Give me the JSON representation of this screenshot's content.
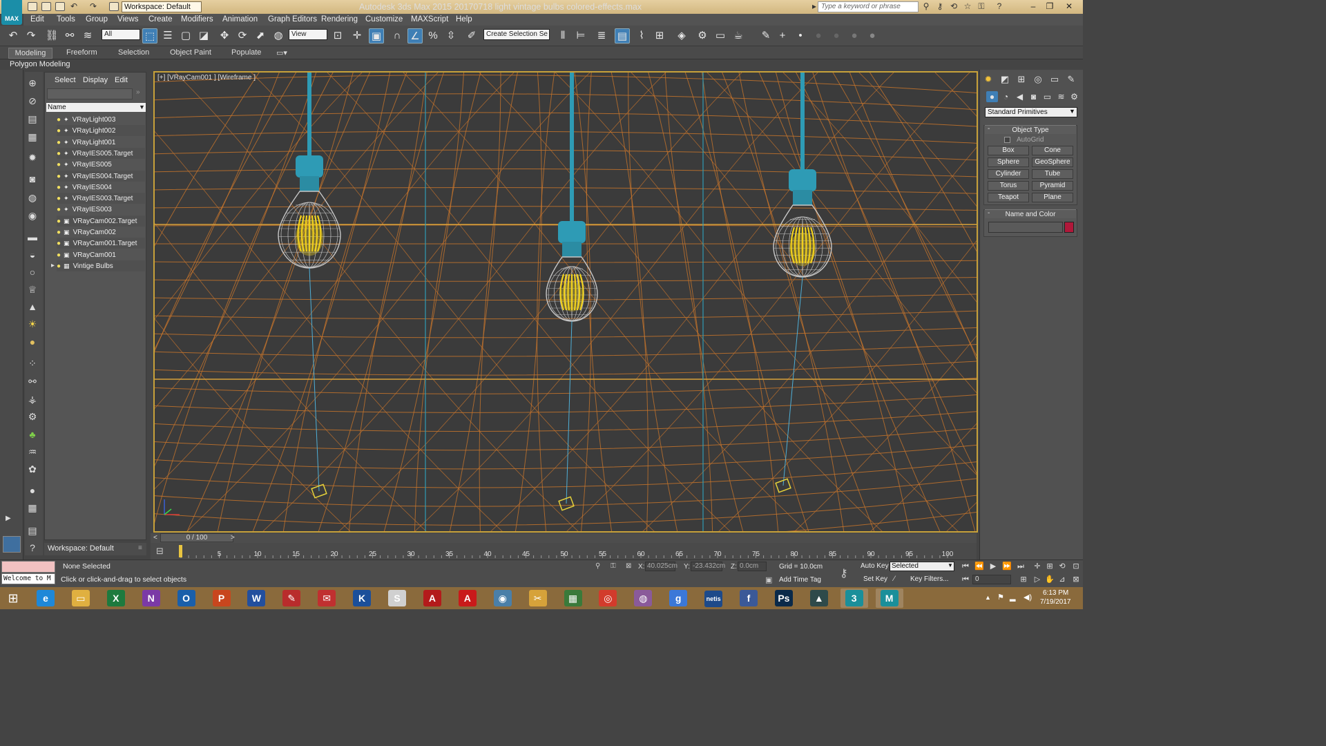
{
  "window": {
    "app_badge": "MAX",
    "title": "Autodesk 3ds Max  2015     20170718 light vintage bulbs colored-effects.max",
    "workspace": "Workspace: Default",
    "search_placeholder": "Type a keyword or phrase",
    "controls": [
      "–",
      "❐",
      "✕"
    ]
  },
  "menu": [
    "Edit",
    "Tools",
    "Group",
    "Views",
    "Create",
    "Modifiers",
    "Animation",
    "Graph Editors",
    "Rendering",
    "Customize",
    "MAXScript",
    "Help"
  ],
  "toolbar": {
    "selection_filter": "All",
    "ref_coord": "View",
    "named_selection": "Create Selection Se"
  },
  "ribbon": {
    "tabs": [
      "Modeling",
      "Freeform",
      "Selection",
      "Object Paint",
      "Populate"
    ],
    "sub_label": "Polygon Modeling"
  },
  "explorer": {
    "tabs": [
      "Select",
      "Display",
      "Edit"
    ],
    "column_header": "Name",
    "items": [
      {
        "name": "VRayLight003",
        "kind": "light"
      },
      {
        "name": "VRayLight002",
        "kind": "light"
      },
      {
        "name": "VRayLight001",
        "kind": "light"
      },
      {
        "name": "VRayIES005.Target",
        "kind": "light"
      },
      {
        "name": "VRayIES005",
        "kind": "light"
      },
      {
        "name": "VRayIES004.Target",
        "kind": "light"
      },
      {
        "name": "VRayIES004",
        "kind": "light"
      },
      {
        "name": "VRayIES003.Target",
        "kind": "light"
      },
      {
        "name": "VRayIES003",
        "kind": "light"
      },
      {
        "name": "VRayCam002.Target",
        "kind": "camera"
      },
      {
        "name": "VRayCam002",
        "kind": "camera"
      },
      {
        "name": "VRayCam001.Target",
        "kind": "camera"
      },
      {
        "name": "VRayCam001",
        "kind": "camera"
      },
      {
        "name": "Vintige Bulbs",
        "kind": "group"
      }
    ],
    "workspace_label": "Workspace: Default"
  },
  "viewport": {
    "label": "[+] [VRayCam001 ] [Wireframe ]",
    "colors": {
      "grid": "#c6742c",
      "cable": "#2e9bb5",
      "filament": "#f2d21e",
      "bulb_glass": "#c8c8c8",
      "frame": "#c8a23a"
    }
  },
  "command_panel": {
    "category_dropdown": "Standard Primitives",
    "object_type_title": "Object Type",
    "autogrid_label": "AutoGrid",
    "primitives": [
      "Box",
      "Cone",
      "Sphere",
      "GeoSphere",
      "Cylinder",
      "Tube",
      "Torus",
      "Pyramid",
      "Teapot",
      "Plane"
    ],
    "name_color_title": "Name and Color",
    "object_color": "#b0183a"
  },
  "timeline": {
    "frame_display": "0 / 100",
    "ticks": [
      "5",
      "10",
      "15",
      "20",
      "25",
      "30",
      "35",
      "40",
      "45",
      "50",
      "55",
      "60",
      "65",
      "70",
      "75",
      "80",
      "85",
      "90",
      "95",
      "100"
    ]
  },
  "status": {
    "maxscript_text": "Welcome to M",
    "selection": "None Selected",
    "prompt": "Click or click-and-drag to select objects",
    "x_label": "X:",
    "x_value": "40.025cm",
    "y_label": "Y:",
    "y_value": "-23.432cm",
    "z_label": "Z:",
    "z_value": "0.0cm",
    "grid": "Grid = 10.0cm",
    "add_time_tag": "Add Time Tag",
    "auto_key": "Auto Key",
    "auto_key_mode": "Selected",
    "set_key": "Set Key",
    "key_filters": "Key Filters...",
    "current_frame": "0"
  },
  "taskbar": {
    "apps": [
      {
        "name": "internet-explorer",
        "label": "e",
        "color": "#1e88d8"
      },
      {
        "name": "file-explorer",
        "label": "▭",
        "color": "#e0b040"
      },
      {
        "name": "excel",
        "label": "X",
        "color": "#1d7a3e"
      },
      {
        "name": "onenote",
        "label": "N",
        "color": "#7b3aa6"
      },
      {
        "name": "outlook",
        "label": "O",
        "color": "#1a5faa"
      },
      {
        "name": "powerpoint",
        "label": "P",
        "color": "#c8461e"
      },
      {
        "name": "word",
        "label": "W",
        "color": "#234f9e"
      },
      {
        "name": "app-red-1",
        "label": "✎",
        "color": "#b92c2c"
      },
      {
        "name": "app-red-2",
        "label": "✉",
        "color": "#c03030"
      },
      {
        "name": "app-blue-k",
        "label": "K",
        "color": "#1b4f9a"
      },
      {
        "name": "app-swirl",
        "label": "S",
        "color": "#d0d0d0"
      },
      {
        "name": "acrobat",
        "label": "A",
        "color": "#b31b1b"
      },
      {
        "name": "adobe",
        "label": "A",
        "color": "#c91a1a"
      },
      {
        "name": "app-globe",
        "label": "◉",
        "color": "#4a7fa8"
      },
      {
        "name": "app-tools",
        "label": "✂",
        "color": "#d6a23a"
      },
      {
        "name": "windows-store",
        "label": "▦",
        "color": "#3a7a3a"
      },
      {
        "name": "chrome",
        "label": "◎",
        "color": "#d23b2c"
      },
      {
        "name": "dvd",
        "label": "◍",
        "color": "#8a5a9a"
      },
      {
        "name": "google",
        "label": "g",
        "color": "#3b78d8"
      },
      {
        "name": "netis",
        "label": "netis",
        "color": "#1d4a8a"
      },
      {
        "name": "facebook",
        "label": "f",
        "color": "#3b5998"
      },
      {
        "name": "photoshop",
        "label": "Ps",
        "color": "#0a2a4a"
      },
      {
        "name": "app-mountain",
        "label": "▲",
        "color": "#2e4a4a"
      },
      {
        "name": "3dsmax-2015",
        "label": "3",
        "color": "#1a8f9a"
      },
      {
        "name": "3dsmax",
        "label": "M",
        "color": "#1a8f9a"
      }
    ],
    "time": "6:13 PM",
    "date": "7/19/2017"
  }
}
